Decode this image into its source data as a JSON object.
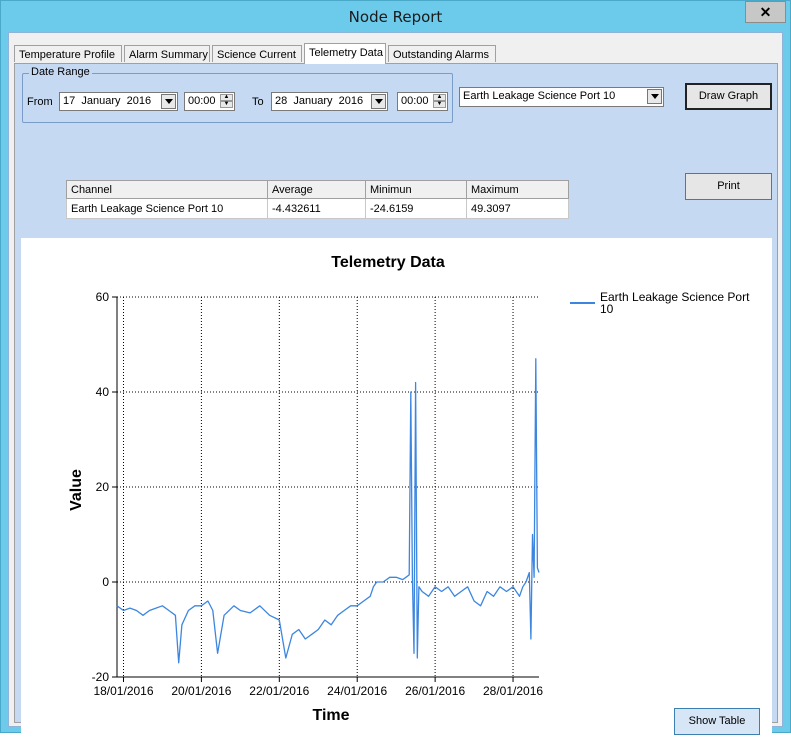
{
  "window": {
    "title": "Node Report",
    "close_glyph": "✕"
  },
  "tabs": [
    {
      "label": "Temperature Profile",
      "active": false
    },
    {
      "label": "Alarm Summary",
      "active": false
    },
    {
      "label": "Science Current",
      "active": false
    },
    {
      "label": "Telemetry Data",
      "active": true
    },
    {
      "label": "Outstanding Alarms",
      "active": false
    }
  ],
  "date_range": {
    "group_label": "Date Range",
    "from_label": "From",
    "from_day": "17",
    "from_month": "January",
    "from_year": "2016",
    "from_time": "00:00",
    "to_label": "To",
    "to_day": "28",
    "to_month": "January",
    "to_year": "2016",
    "to_time": "00:00"
  },
  "channel_select": {
    "value": "Earth Leakage Science Port 10"
  },
  "buttons": {
    "draw_graph": "Draw Graph",
    "print": "Print",
    "show_table": "Show Table"
  },
  "stats_table": {
    "headers": [
      "Channel",
      "Average",
      "Minimun",
      "Maximum"
    ],
    "rows": [
      [
        "Earth Leakage Science Port 10",
        "-4.432611",
        "-24.6159",
        "49.3097"
      ]
    ]
  },
  "chart_data": {
    "type": "line",
    "title": "Telemetry Data",
    "xlabel": "Time",
    "ylabel": "Value",
    "ylim": [
      -20,
      60
    ],
    "yticks": [
      "-20",
      "0",
      "20",
      "40",
      "60"
    ],
    "xlim": [
      "2016-01-17T20:00",
      "2016-01-28T16:00"
    ],
    "xticks": [
      "18/01/2016",
      "20/01/2016",
      "22/01/2016",
      "24/01/2016",
      "26/01/2016",
      "28/01/2016"
    ],
    "grid": true,
    "legend_position": "top-right",
    "series": [
      {
        "name": "Earth Leakage Science Port 10",
        "color": "#3d86e0",
        "x": [
          "2016-01-17T20:00",
          "2016-01-18T00:00",
          "2016-01-18T04:00",
          "2016-01-18T08:00",
          "2016-01-18T12:00",
          "2016-01-18T16:00",
          "2016-01-18T20:00",
          "2016-01-19T00:00",
          "2016-01-19T04:00",
          "2016-01-19T08:00",
          "2016-01-19T10:00",
          "2016-01-19T12:00",
          "2016-01-19T16:00",
          "2016-01-19T20:00",
          "2016-01-20T00:00",
          "2016-01-20T04:00",
          "2016-01-20T07:00",
          "2016-01-20T10:00",
          "2016-01-20T14:00",
          "2016-01-20T20:00",
          "2016-01-21T00:00",
          "2016-01-21T06:00",
          "2016-01-21T12:00",
          "2016-01-21T18:00",
          "2016-01-22T00:00",
          "2016-01-22T04:00",
          "2016-01-22T08:00",
          "2016-01-22T12:00",
          "2016-01-22T16:00",
          "2016-01-22T20:00",
          "2016-01-23T00:00",
          "2016-01-23T04:00",
          "2016-01-23T08:00",
          "2016-01-23T12:00",
          "2016-01-23T16:00",
          "2016-01-23T20:00",
          "2016-01-24T00:00",
          "2016-01-24T04:00",
          "2016-01-24T08:00",
          "2016-01-24T10:00",
          "2016-01-24T12:00",
          "2016-01-24T16:00",
          "2016-01-24T20:00",
          "2016-01-25T00:00",
          "2016-01-25T04:00",
          "2016-01-25T06:00",
          "2016-01-25T08:00",
          "2016-01-25T09:00",
          "2016-01-25T10:00",
          "2016-01-25T11:00",
          "2016-01-25T12:00",
          "2016-01-25T13:00",
          "2016-01-25T14:00",
          "2016-01-25T16:00",
          "2016-01-25T20:00",
          "2016-01-26T00:00",
          "2016-01-26T04:00",
          "2016-01-26T08:00",
          "2016-01-26T12:00",
          "2016-01-26T16:00",
          "2016-01-26T20:00",
          "2016-01-27T00:00",
          "2016-01-27T04:00",
          "2016-01-27T08:00",
          "2016-01-27T12:00",
          "2016-01-27T16:00",
          "2016-01-27T20:00",
          "2016-01-28T00:00",
          "2016-01-28T04:00",
          "2016-01-28T06:00",
          "2016-01-28T08:00",
          "2016-01-28T10:00",
          "2016-01-28T11:00",
          "2016-01-28T12:00",
          "2016-01-28T13:00",
          "2016-01-28T14:00",
          "2016-01-28T15:00",
          "2016-01-28T16:00"
        ],
        "y": [
          -5,
          -6,
          -5.5,
          -6,
          -7,
          -6,
          -5.5,
          -5,
          -6,
          -7,
          -17,
          -9,
          -6,
          -5,
          -5,
          -4,
          -6,
          -15,
          -7,
          -5,
          -6,
          -6.5,
          -5,
          -7,
          -8,
          -16,
          -11,
          -10,
          -12,
          -11,
          -10,
          -8,
          -9,
          -7,
          -6,
          -5,
          -5,
          -4,
          -3,
          -1,
          0,
          0,
          1,
          1,
          0.5,
          1,
          1.5,
          40,
          1,
          -15,
          42,
          -16,
          -1,
          -2,
          -3,
          -1,
          -2,
          -1,
          -3,
          -2,
          -1,
          -4,
          -5,
          -2,
          -3,
          -1,
          -2,
          -1,
          -3,
          -1,
          0,
          2,
          -12,
          10,
          1,
          47,
          3,
          2
        ]
      }
    ]
  }
}
